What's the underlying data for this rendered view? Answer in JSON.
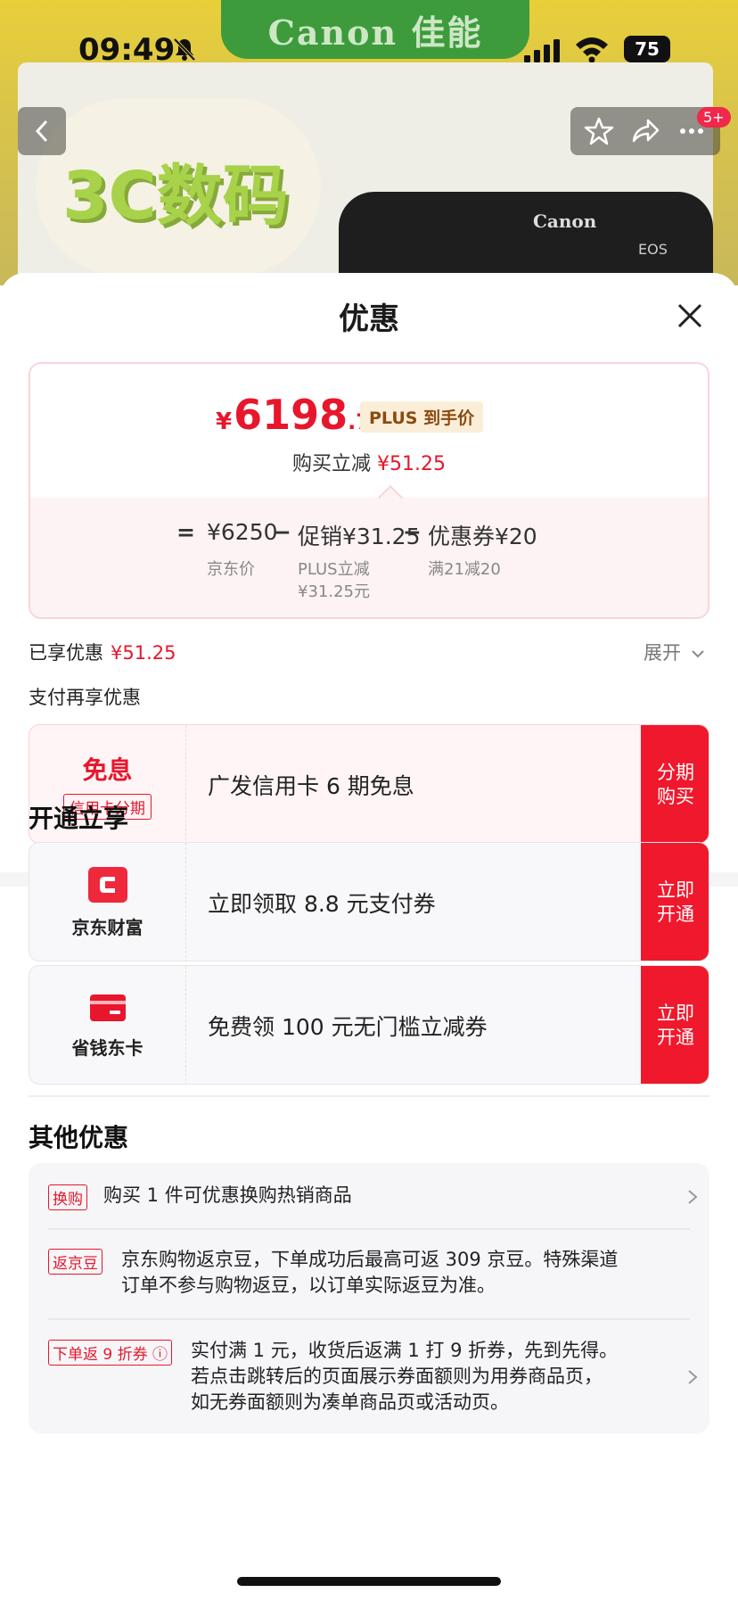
{
  "status_bar": {
    "time": "09:49",
    "battery": "75"
  },
  "header": {
    "brand": "Canon 佳能",
    "category": "3C数码",
    "camera_brand": "Canon",
    "camera_model": "EOS",
    "badge": "5+"
  },
  "sheet": {
    "title": "优惠"
  },
  "price_card": {
    "currency": "¥",
    "final_int": "6198",
    "final_dec": ".75",
    "plus_tag": "PLUS 到手价",
    "discount_label": "购买立减",
    "discount_amount": "¥51.25",
    "formula": {
      "equals": "=",
      "jd_price": "¥6250",
      "jd_price_label": "京东价",
      "minus1": "−",
      "promo": "促销¥31.25",
      "promo_sub1": "PLUS立减",
      "promo_sub2": "¥31.25元",
      "minus2": "−",
      "coupon": "优惠券¥20",
      "coupon_sub": "满21减20"
    }
  },
  "enjoyed": {
    "label": "已享优惠",
    "amount": "¥51.25",
    "expand": "展开"
  },
  "pay_more": {
    "label": "支付再享优惠"
  },
  "installment": {
    "title": "免息",
    "tag": "信用卡分期",
    "desc": "广发信用卡 6 期免息",
    "button": "分期\n购买"
  },
  "open_section": {
    "title": "开通立享",
    "items": [
      {
        "brand": "京东财富",
        "desc": "立即领取 8.8 元支付券",
        "button": "立即\n开通",
        "color": "#f0182c"
      },
      {
        "brand": "省钱东卡",
        "desc": "免费领 100 元无门槛立减券",
        "button": "立即\n开通",
        "color": "#e8162c"
      }
    ]
  },
  "other_section": {
    "title": "其他优惠",
    "rows": [
      {
        "tag": "换购",
        "text1": "购买 1 件可优惠换购热销商品",
        "text2": "",
        "text3": ""
      },
      {
        "tag": "返京豆",
        "text1": "京东购物返京豆，下单成功后最高可返 309 京豆。特殊渠道",
        "text2": "订单不参与购物返豆，以订单实际返豆为准。",
        "text3": ""
      },
      {
        "tag": "下单返 9 折券 ⓘ",
        "text1": "实付满 1 元，收货后返满 1 打 9 折券，先到先得。",
        "text2": "若点击跳转后的页面展示券面额则为用券商品页，",
        "text3": "如无券面额则为凑单商品页或活动页。"
      }
    ]
  },
  "colors": {
    "accent": "#e8162c",
    "button_red": "#f0182c",
    "plus_gold": "#8a4a10"
  }
}
